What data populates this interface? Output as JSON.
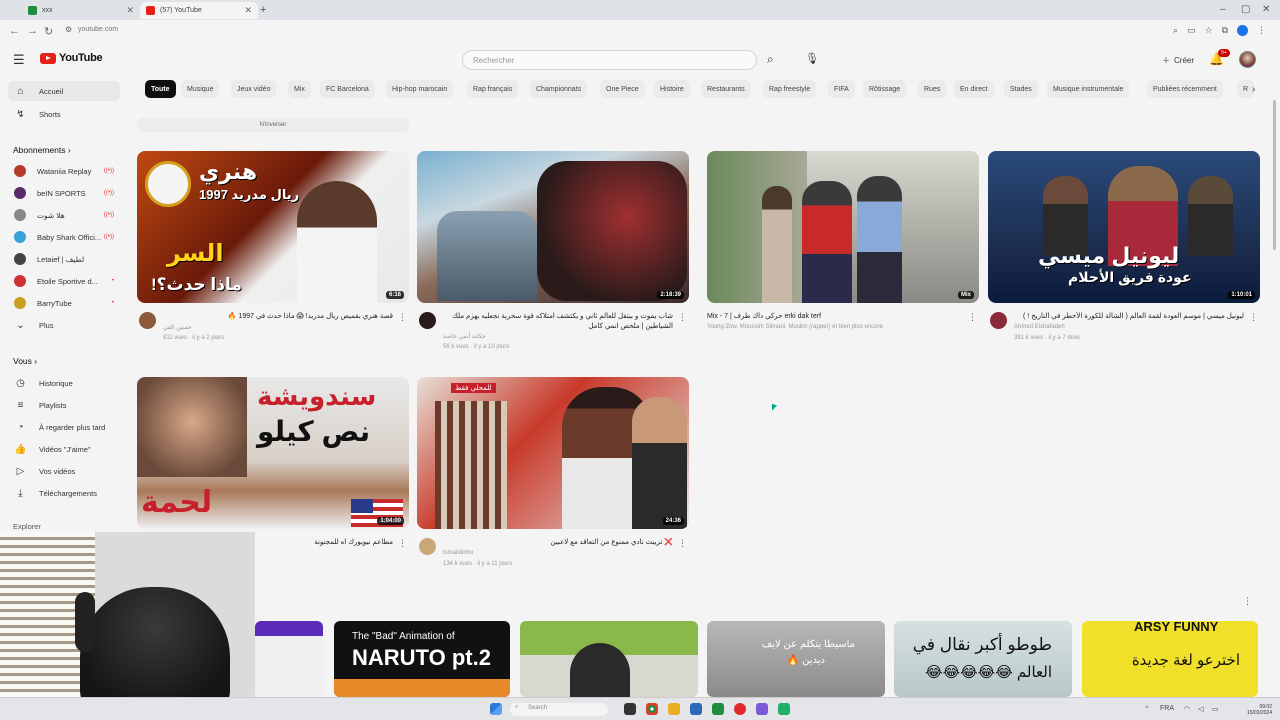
{
  "browser": {
    "tabs": [
      {
        "label": "xxx",
        "fav_color": "#1e8e3e"
      },
      {
        "label": "(57) YouTube",
        "fav_color": "#e62117"
      }
    ],
    "url": "youtube.com"
  },
  "header": {
    "logo_text": "YouTube",
    "search_placeholder": "Rechercher",
    "create_label": "Créer",
    "notif_count": "9+"
  },
  "sidebar": {
    "main": [
      {
        "label": "Accueil",
        "icon": "home-icon"
      },
      {
        "label": "Shorts",
        "icon": "shorts-icon"
      }
    ],
    "subs_header": "Abonnements",
    "subs": [
      {
        "label": "Wataniia Replay",
        "color": "#b53a2a"
      },
      {
        "label": "beIN SPORTS",
        "color": "#5a2a6a"
      },
      {
        "label": "هلا شوت",
        "color": "#888"
      },
      {
        "label": "Baby Shark Offici...",
        "color": "#3aa0d8"
      },
      {
        "label": "Letaief | لطيف",
        "color": "#444"
      },
      {
        "label": "Etoile Sportive d...",
        "color": "#c33"
      },
      {
        "label": "BarryTube",
        "color": "#c8a020"
      }
    ],
    "more_label": "Plus",
    "you_header": "Vous",
    "you": [
      {
        "label": "Historique",
        "icon": "history-icon"
      },
      {
        "label": "Playlists",
        "icon": "playlists-icon"
      },
      {
        "label": "À regarder plus tard",
        "icon": "watch-later-icon"
      },
      {
        "label": "Vidéos \"J'aime\"",
        "icon": "like-icon"
      },
      {
        "label": "Vos vidéos",
        "icon": "your-videos-icon"
      },
      {
        "label": "Téléchargements",
        "icon": "download-icon"
      }
    ],
    "explore_header": "Explorer"
  },
  "chips": [
    "Toute",
    "Musique",
    "Jeux vidéo",
    "Mix",
    "FC Barcelona",
    "Hip-hop marocain",
    "Rap français",
    "Championnats",
    "One Piece",
    "Histoire",
    "Restaurants",
    "Rap freestyle",
    "FIFA",
    "Rôtissage",
    "Rues",
    "En direct",
    "Stades",
    "Musique instrumentale",
    "Publiées récemment",
    "R"
  ],
  "invert_label": "N'inverser",
  "videos": [
    {
      "title": "قصة هنري بقميص ريال مدريد! 😱 ماذا حدث في 1997 🔥",
      "channel": "حسين الفي",
      "stats": "811 vues · il y a 2 jours",
      "duration": "6:16",
      "thumb_text_1": "هنري",
      "thumb_text_2": "ريال مدريد 1997",
      "thumb_text_3": "السر",
      "thumb_text_4": "ماذا حدث؟!"
    },
    {
      "title": "شاب يموت و يبتقل للعالم ثاني و يكتشف امتلاكه قوة سحرية نجعليه يهزم ملك الشياطين | ملخص انمي كامل",
      "channel": "حكاية أنمي خاصة",
      "stats": "56 k vues · il y a 10 jours",
      "duration": "2:18:39"
    },
    {
      "title": "Mix - 7 | حركي داك طرف erki dak terf",
      "channel": "Young Zow, Moussim Slimani, Muslim (rapper) et bien plus encore",
      "stats": "",
      "duration": "Mix"
    },
    {
      "title": "ليونيل ميسي | موسم العودة لقمة العالم ( الشالة للكورة الأخطر في التاريخ ! )",
      "channel": "Ahmed Elshafadeh",
      "stats": "391 k vues · il y a 7 mois",
      "duration": "1:10:01",
      "thumb_text_1": "ليونيل ميسي",
      "thumb_text_2": "عودة فريق الأحلام"
    },
    {
      "title": "مطاعم نيويورك اه للمجنونة",
      "channel": "",
      "stats": "",
      "duration": "1:04:00",
      "thumb_text_1": "سندويشة",
      "thumb_text_2": "نص كيلو",
      "thumb_text_3": "لحمة"
    },
    {
      "title": "❌ تريبث نادي ممنوع من التعاقد مع لاعبين",
      "channel": "Ismaildinho",
      "stats": "134 k vues · il y a 11 jours",
      "duration": "24:36",
      "thumb_text_1": "للمحلي فقط"
    }
  ],
  "shorts": [
    {
      "text": ""
    },
    {
      "text": "The \"Bad\" Animation of",
      "text2": "NARUTO pt.2"
    },
    {
      "text": ""
    },
    {
      "text": "ماسيطا يتكلم عن لايف",
      "text2": "ديدين 🔥"
    },
    {
      "text": "طوطو أكبر نقال في",
      "text2": "العالم 😂😂😂😂😂"
    },
    {
      "text": "ARSY FUNNY",
      "text2": "اخترعو لغة جديدة"
    }
  ],
  "taskbar": {
    "search_placeholder": "Search",
    "lang": "FRA",
    "time": "09:02",
    "date": "15/03/2024"
  }
}
